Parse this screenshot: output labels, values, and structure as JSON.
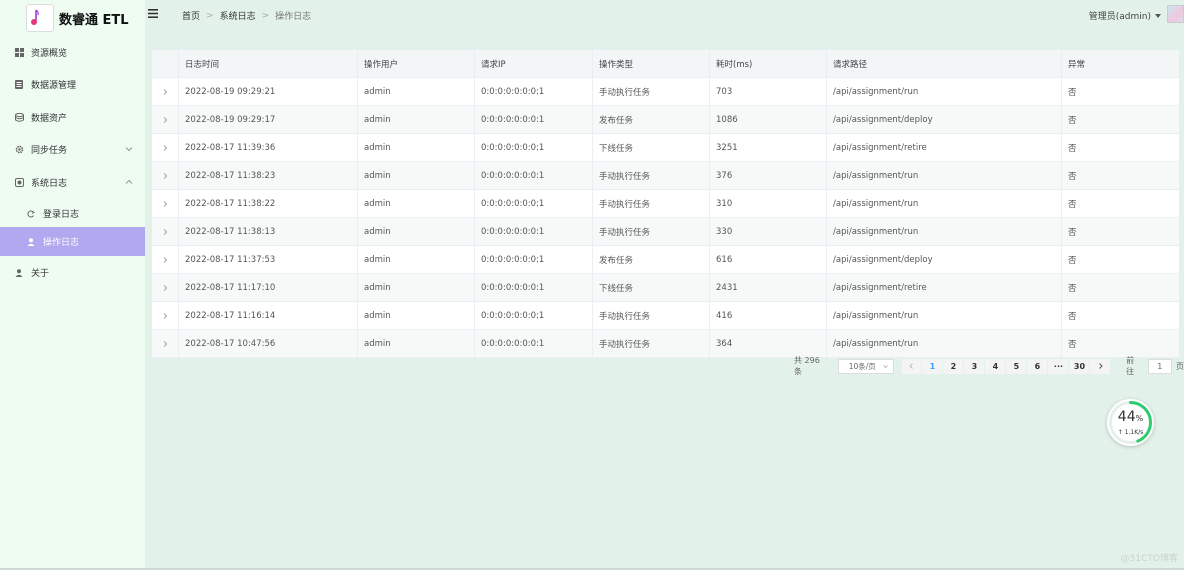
{
  "app": {
    "title": "数睿通 ETL",
    "logo_text": "数睿通 ETL"
  },
  "sidebar": {
    "items": [
      {
        "label": "资源概览",
        "icon": "grid-icon"
      },
      {
        "label": "数据源管理",
        "icon": "database-icon"
      },
      {
        "label": "数据资产",
        "icon": "storage-icon"
      },
      {
        "label": "同步任务",
        "icon": "gear-icon"
      },
      {
        "label": "系统日志",
        "icon": "log-icon"
      },
      {
        "label": "登录日志",
        "icon": "login-icon"
      },
      {
        "label": "操作日志",
        "icon": "user-icon"
      },
      {
        "label": "关于",
        "icon": "person-icon"
      }
    ],
    "active": "操作日志"
  },
  "header": {
    "breadcrumb": [
      "首页",
      "系统日志",
      "操作日志"
    ],
    "user": "管理员(admin)"
  },
  "table": {
    "columns": [
      "日志时间",
      "操作用户",
      "请求IP",
      "操作类型",
      "耗时(ms)",
      "请求路径",
      "异常"
    ],
    "rows": [
      [
        "2022-08-19 09:29:21",
        "admin",
        "0:0:0:0:0:0:0:1",
        "手动执行任务",
        "703",
        "/api/assignment/run",
        "否"
      ],
      [
        "2022-08-19 09:29:17",
        "admin",
        "0:0:0:0:0:0:0:1",
        "发布任务",
        "1086",
        "/api/assignment/deploy",
        "否"
      ],
      [
        "2022-08-17 11:39:36",
        "admin",
        "0:0:0:0:0:0:0:1",
        "下线任务",
        "3251",
        "/api/assignment/retire",
        "否"
      ],
      [
        "2022-08-17 11:38:23",
        "admin",
        "0:0:0:0:0:0:0:1",
        "手动执行任务",
        "376",
        "/api/assignment/run",
        "否"
      ],
      [
        "2022-08-17 11:38:22",
        "admin",
        "0:0:0:0:0:0:0:1",
        "手动执行任务",
        "310",
        "/api/assignment/run",
        "否"
      ],
      [
        "2022-08-17 11:38:13",
        "admin",
        "0:0:0:0:0:0:0:1",
        "手动执行任务",
        "330",
        "/api/assignment/run",
        "否"
      ],
      [
        "2022-08-17 11:37:53",
        "admin",
        "0:0:0:0:0:0:0:1",
        "发布任务",
        "616",
        "/api/assignment/deploy",
        "否"
      ],
      [
        "2022-08-17 11:17:10",
        "admin",
        "0:0:0:0:0:0:0:1",
        "下线任务",
        "2431",
        "/api/assignment/retire",
        "否"
      ],
      [
        "2022-08-17 11:16:14",
        "admin",
        "0:0:0:0:0:0:0:1",
        "手动执行任务",
        "416",
        "/api/assignment/run",
        "否"
      ],
      [
        "2022-08-17 10:47:56",
        "admin",
        "0:0:0:0:0:0:0:1",
        "手动执行任务",
        "364",
        "/api/assignment/run",
        "否"
      ]
    ]
  },
  "pagination": {
    "total": "共 296 条",
    "page_size": "10条/页",
    "pages": [
      "1",
      "2",
      "3",
      "4",
      "5",
      "6",
      "···",
      "30"
    ],
    "current": "1",
    "goto_label": "前往",
    "goto_value": "1",
    "goto_suffix": "页"
  },
  "speed_widget": {
    "percent": "44",
    "percent_unit": "%",
    "rate": "↑ 1.1K/s",
    "progress": 0.44
  },
  "watermark": "@51CTO博客",
  "colors": {
    "accent": "#b2a8f0",
    "link": "#409eff",
    "ring": "#2ecc71"
  }
}
